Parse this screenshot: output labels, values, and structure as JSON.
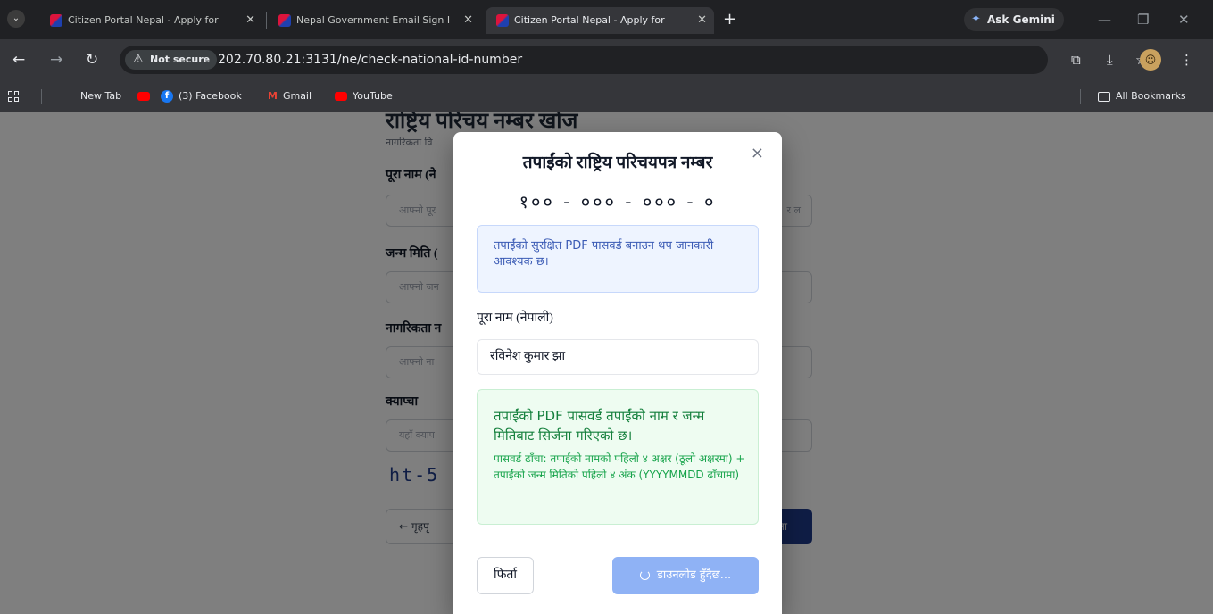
{
  "browser": {
    "tabs": [
      {
        "title": "Citizen Portal Nepal - Apply for",
        "active": false
      },
      {
        "title": "Nepal Government Email Sign I",
        "active": false
      },
      {
        "title": "Citizen Portal Nepal - Apply for",
        "active": true
      }
    ],
    "new_tab": "+",
    "gemini_label": "Ask Gemini",
    "security_label": "Not secure",
    "url": "202.70.80.21:3131/ne/check-national-id-number",
    "bookmarks": [
      "New Tab",
      "(3) Facebook",
      "Gmail",
      "YouTube"
    ],
    "all_bookmarks": "All Bookmarks"
  },
  "background_page": {
    "title": "राष्ट्रिय परिचय नम्बर खोज",
    "subtitle": "नागरिकता वि",
    "fields": [
      {
        "label": "पूरा नाम (ने",
        "placeholder": "आफ्नो पूर"
      },
      {
        "label": "जन्म मिति (",
        "placeholder": "आफ्नो जन"
      },
      {
        "label": "नागरिकता न",
        "placeholder": "आफ्नो ना"
      },
      {
        "label": "क्याप्चा",
        "placeholder": "यहाँ क्याप"
      }
    ],
    "input_right_fragment": "र ल",
    "captcha": "ht-5 n",
    "back_button": "← गृहपृ",
    "submit_fragment": "जा"
  },
  "modal": {
    "close": "×",
    "title": "तपाईंको राष्ट्रिय परिचयपत्र नम्बर",
    "national_id": "१०० - ००० - ००० - ०",
    "info": "तपाईंको सुरक्षित PDF पासवर्ड बनाउन थप जानकारी आवश्यक छ।",
    "name_label": "पूरा नाम (नेपाली)",
    "name_value": "रविनेश कुमार झा",
    "success_main": "तपाईंको PDF पासवर्ड तपाईंको नाम र जन्म मितिबाट सिर्जना गरिएको छ।",
    "success_sub": "पासवर्ड ढाँचा: तपाईंको नामको पहिलो ४ अक्षर (ठूलो अक्षरमा) + तपाईंको जन्म मितिको पहिलो ४ अंक (YYYYMMDD ढाँचामा)",
    "cancel_label": "फिर्ता",
    "download_label": "डाउनलोड हुँदैछ..."
  },
  "colors": {
    "download_button": "#8fb2f5",
    "info_box": "#eef4ff",
    "success_box": "#eefcf1",
    "success_text": "#15803d"
  }
}
